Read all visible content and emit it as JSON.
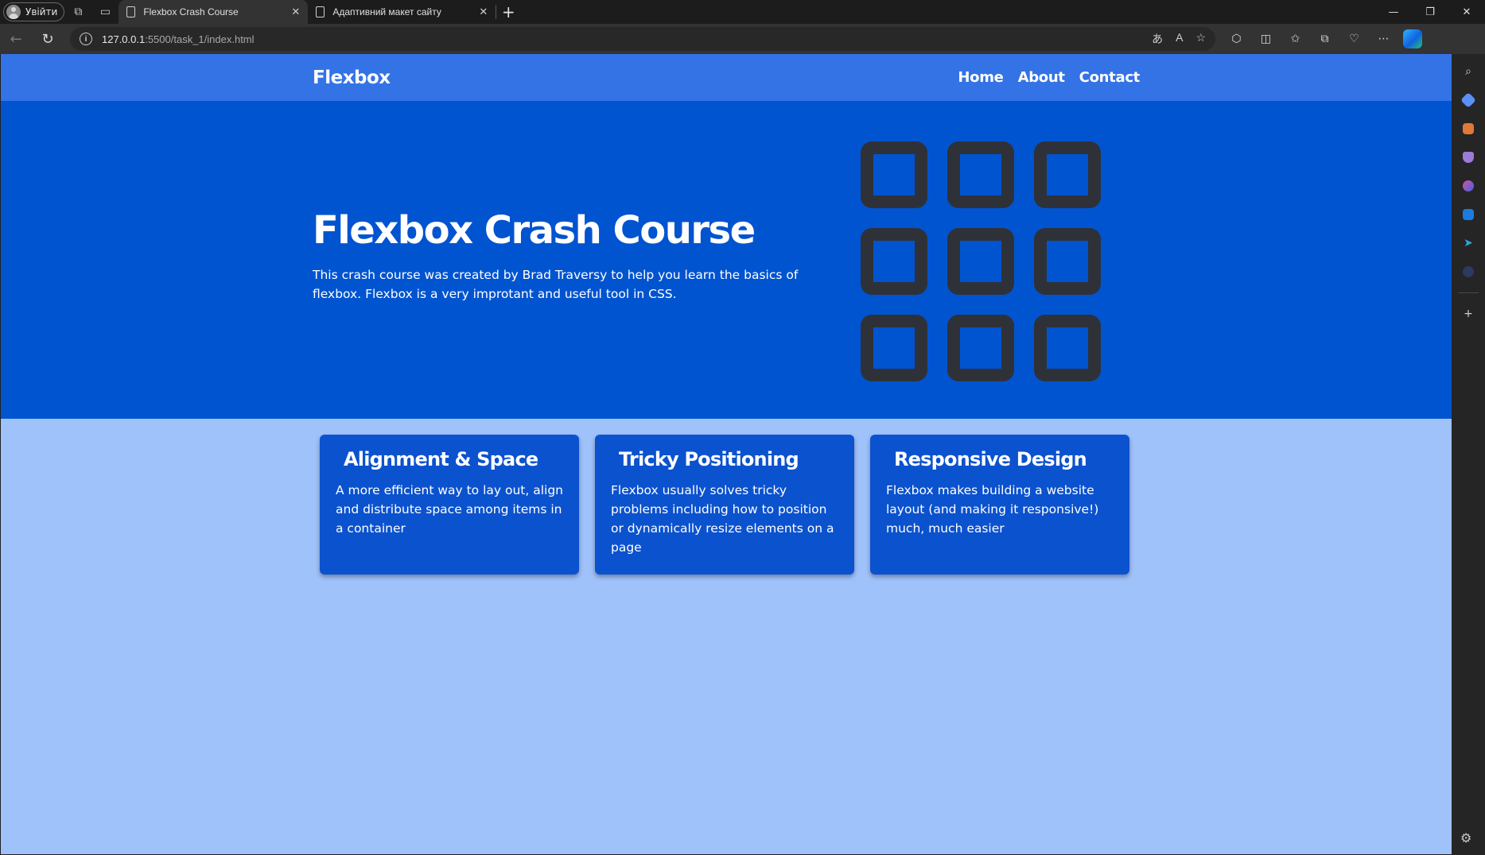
{
  "browser": {
    "profile_label": "Увійти",
    "tabs": [
      {
        "title": "Flexbox Crash Course",
        "active": true
      },
      {
        "title": "Адаптивний макет сайту",
        "active": false
      }
    ],
    "url_host": "127.0.0.1",
    "url_rest": ":5500/task_1/index.html"
  },
  "site": {
    "logo": "Flexbox",
    "nav": [
      "Home",
      "About",
      "Contact"
    ],
    "hero": {
      "title": "Flexbox Crash Course",
      "description": "This crash course was created by Brad Traversy to help you learn the basics of flexbox. Flexbox is a very improtant and useful tool in CSS."
    },
    "cards": [
      {
        "title": "Alignment & Space",
        "text": "A more efficient way to lay out, align and distribute space among items in a container"
      },
      {
        "title": "Tricky Positioning",
        "text": "Flexbox usually solves tricky problems including how to position or dynamically resize elements on a page"
      },
      {
        "title": "Responsive Design",
        "text": "Flexbox makes building a website layout (and making it responsive!) much, much easier"
      }
    ]
  },
  "colors": {
    "nav_bg": "#3373e6",
    "hero_bg": "#0154d0",
    "page_bg": "#a0c2fb",
    "card_bg": "#0b52ce",
    "grid_icon": "#2f3138"
  }
}
